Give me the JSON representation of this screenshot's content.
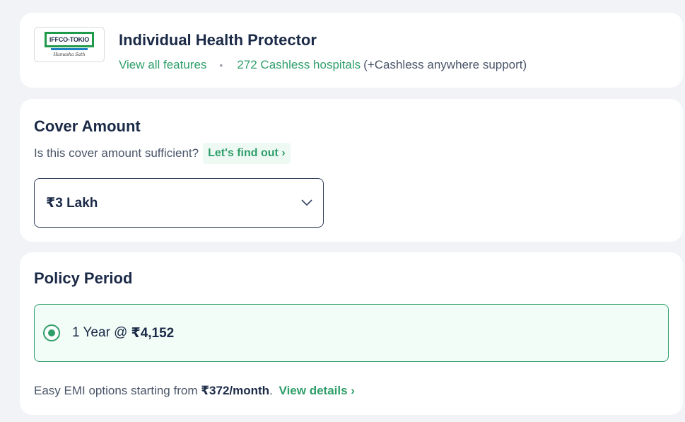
{
  "plan": {
    "insurer_logo_text": "IFFCO-TOKIO",
    "insurer_logo_tagline": "Humesha Sath",
    "title": "Individual Health Protector",
    "view_features": "View all features",
    "separator": "•",
    "cashless_hospitals": "272 Cashless hospitals",
    "cashless_note": "(+Cashless anywhere support)",
    "brand_color": "#2f9e6a"
  },
  "cover": {
    "title": "Cover Amount",
    "question": "Is this cover amount sufficient?",
    "find_out": "Let's find out ›",
    "selected_value": "₹3 Lakh",
    "dropdown_icon": "chevron-down-icon"
  },
  "period": {
    "title": "Policy Period",
    "option_label": "1 Year @",
    "option_price": "₹4,152",
    "option_selected": true,
    "emi_text": "Easy EMI options starting from",
    "emi_amount": "₹372/month",
    "emi_separator": ".",
    "view_details": "View details ›"
  }
}
